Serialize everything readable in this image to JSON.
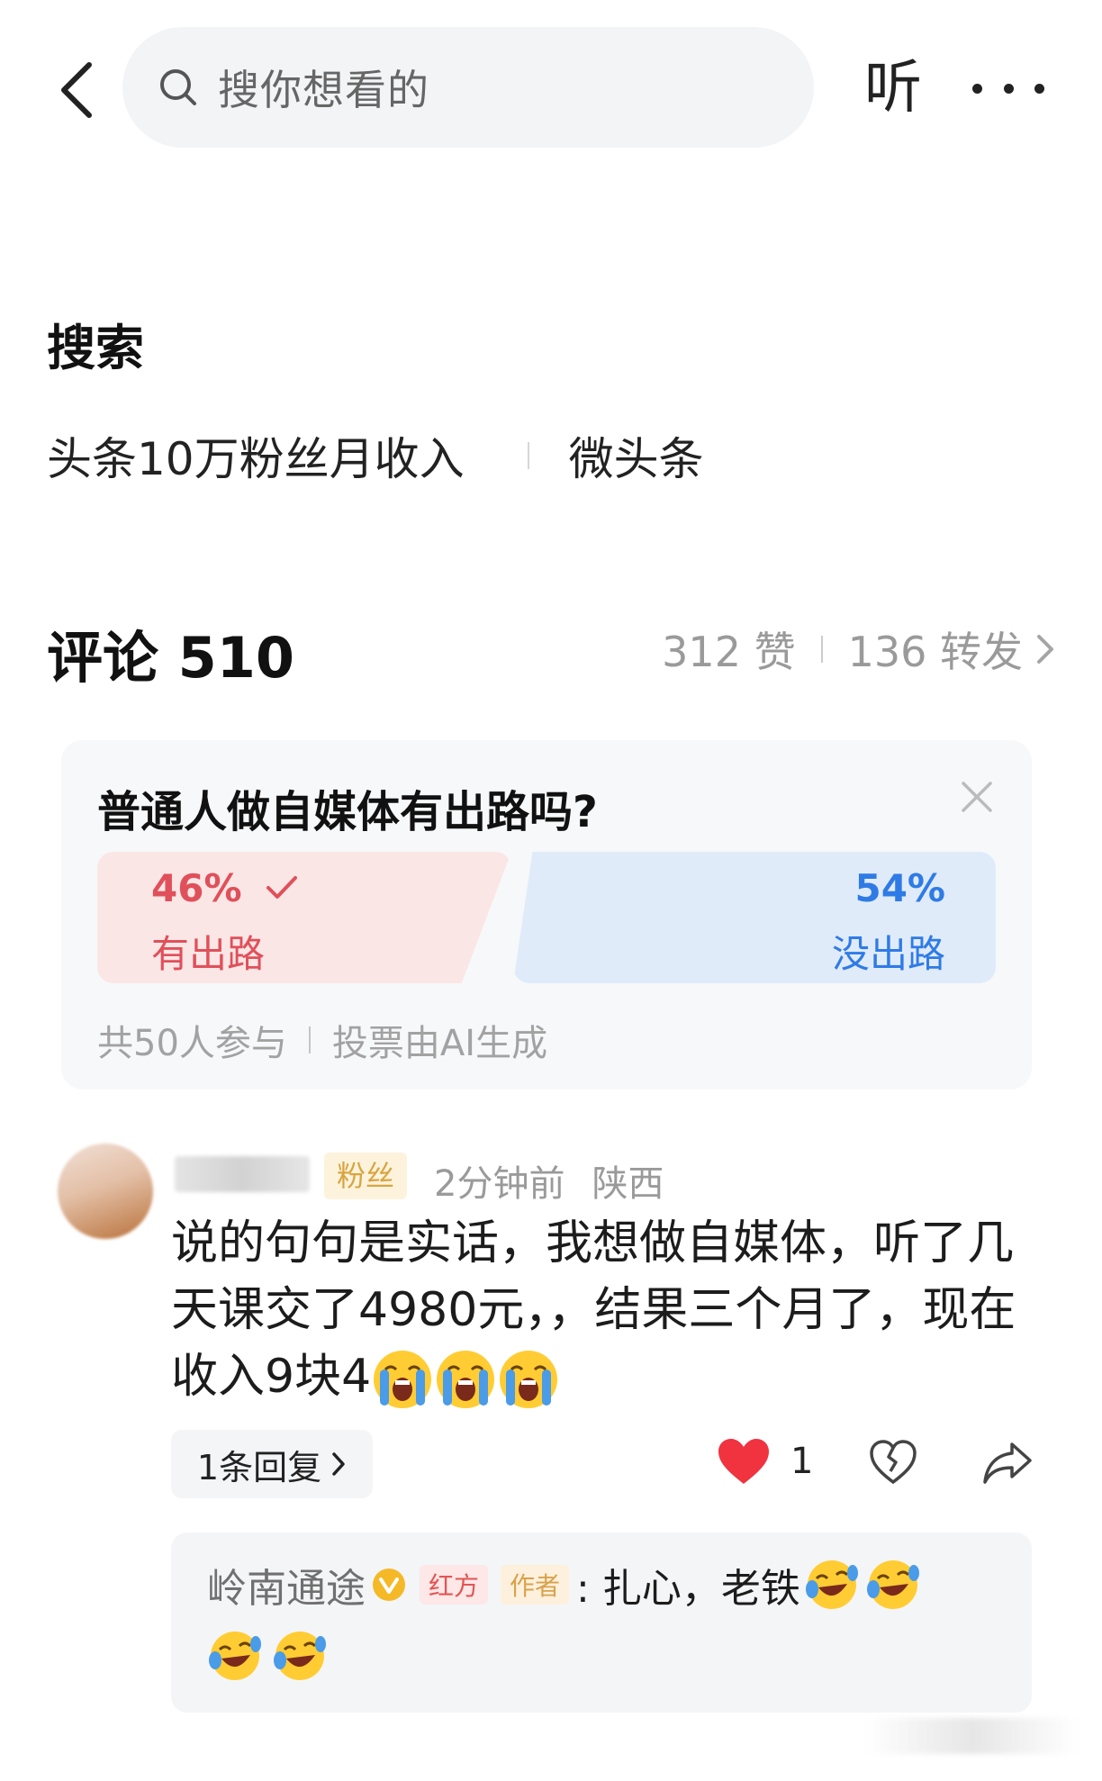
{
  "topbar": {
    "back_icon": "chevron-left-icon",
    "search_icon": "search-icon",
    "search_placeholder": "搜你想看的",
    "listen_label": "听",
    "more_icon": "more-horizontal-icon"
  },
  "search_section": {
    "title": "搜索",
    "terms": [
      "头条10万粉丝月收入",
      "微头条"
    ]
  },
  "comments_header": {
    "title": "评论 510",
    "likes": "312 赞",
    "reposts": "136 转发",
    "chevron_icon": "chevron-right-icon"
  },
  "poll": {
    "question": "普通人做自媒体有出路吗?",
    "close_icon": "close-icon",
    "options": [
      {
        "percent": "46%",
        "label": "有出路",
        "selected": true,
        "value": 46,
        "color": "#e0505a"
      },
      {
        "percent": "54%",
        "label": "没出路",
        "selected": false,
        "value": 54,
        "color": "#2f7be6"
      }
    ],
    "participants": "共50人参与",
    "generated_by": "投票由AI生成"
  },
  "comment": {
    "badge": "粉丝",
    "time": "2分钟前",
    "location": "陕西",
    "text": "说的句句是实话，我想做自媒体，听了几天课交了4980元，，结果三个月了，现在收入9块4",
    "emoji_icon": "crying-face-emoji",
    "reply_count_label": "1条回复",
    "like_count": "1",
    "like_icon": "heart-filled-icon",
    "dislike_icon": "broken-heart-icon",
    "share_icon": "share-icon"
  },
  "reply": {
    "author": "岭南通途",
    "verified_icon": "verified-badge-icon",
    "tag_side": "红方",
    "tag_role": "作者",
    "text": ": 扎心，老铁",
    "emoji_icon": "laughing-tears-emoji"
  },
  "colors": {
    "accent_red": "#e0505a",
    "accent_blue": "#2f7be6",
    "heart": "#f0333f",
    "fan_badge": "#d9a441"
  }
}
